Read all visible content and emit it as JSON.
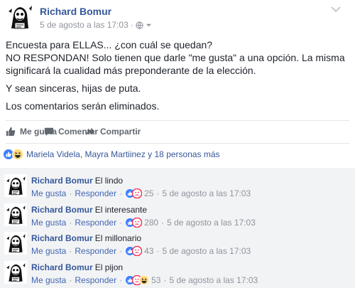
{
  "post": {
    "author": "Richard Bomur",
    "timestamp": "5 de agosto a las 17:03",
    "meta_sep": "·",
    "body": [
      "Encuesta para ELLAS... ¿con cuál se quedan?",
      "NO RESPONDAN! Solo tienen que darle \"me gusta\" a una opción. La misma significará la cualidad más preponderante de la elección.",
      "Y sean sinceras, hijas de puta.",
      "Los comentarios serán eliminados."
    ]
  },
  "actions": {
    "like": "Me gusta",
    "comment": "Comentar",
    "share": "Compartir"
  },
  "reactions": {
    "summary": "Mariela Videla, Mayra Martiinez y 18 personas más"
  },
  "comments": [
    {
      "author": "Richard Bomur",
      "text": "El lindo",
      "like": "Me gusta",
      "reply": "Responder",
      "count": "25",
      "time": "5 de agosto a las 17:03",
      "reactions": [
        "like-icon",
        "angry-icon"
      ]
    },
    {
      "author": "Richard Bomur",
      "text": "El interesante",
      "like": "Me gusta",
      "reply": "Responder",
      "count": "280",
      "time": "5 de agosto a las 17:03",
      "reactions": [
        "like-icon",
        "angry-icon"
      ]
    },
    {
      "author": "Richard Bomur",
      "text": "El millonario",
      "like": "Me gusta",
      "reply": "Responder",
      "count": "43",
      "time": "5 de agosto a las 17:03",
      "reactions": [
        "like-icon",
        "angry-icon"
      ]
    },
    {
      "author": "Richard Bomur",
      "text": "El pijon",
      "like": "Me gusta",
      "reply": "Responder",
      "count": "53",
      "time": "5 de agosto a las 17:03",
      "reactions": [
        "like-icon",
        "angry-icon",
        "haha-icon"
      ]
    }
  ],
  "colors": {
    "link": "#365899",
    "meta": "#90949c",
    "like_blue": "#4080ff",
    "angry_red": "#f0284a",
    "haha_yellow": "#ffd972",
    "comments_bg": "#f2f3f5"
  }
}
